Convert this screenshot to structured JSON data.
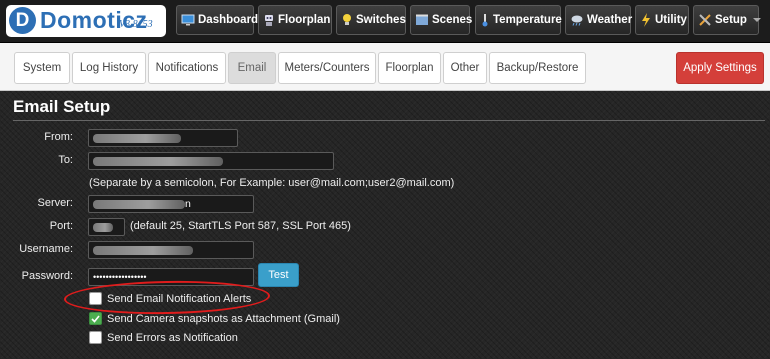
{
  "app": {
    "name": "Domoticz",
    "version": "V3.8153",
    "logo_letter": "D"
  },
  "nav": [
    {
      "label": "Dashboard",
      "icon": "monitor-icon"
    },
    {
      "label": "Floorplan",
      "icon": "robot-icon"
    },
    {
      "label": "Switches",
      "icon": "lightbulb-icon"
    },
    {
      "label": "Scenes",
      "icon": "film-icon"
    },
    {
      "label": "Temperature",
      "icon": "thermometer-icon"
    },
    {
      "label": "Weather",
      "icon": "cloud-rain-icon"
    },
    {
      "label": "Utility",
      "icon": "lightning-icon"
    },
    {
      "label": "Setup",
      "icon": "tools-icon",
      "dropdown": true
    }
  ],
  "tabs": [
    "System",
    "Log History",
    "Notifications",
    "Email",
    "Meters/Counters",
    "Floorplan",
    "Other",
    "Backup/Restore"
  ],
  "active_tab": "Email",
  "apply_button": "Apply Settings",
  "section_title": "Email Setup",
  "form": {
    "from_label": "From:",
    "to_label": "To:",
    "to_hint": "(Separate by a semicolon, For Example: user@mail.com;user2@mail.com)",
    "server_label": "Server:",
    "server_value_visible": "n",
    "port_label": "Port:",
    "port_hint": "(default 25, StartTLS Port 587, SSL Port 465)",
    "username_label": "Username:",
    "password_label": "Password:",
    "password_value": "•••••••••••••••••",
    "test_button": "Test",
    "checkboxes": [
      {
        "label": "Send Email Notification Alerts",
        "checked": false
      },
      {
        "label": "Send Camera snapshots as Attachment (Gmail)",
        "checked": true
      },
      {
        "label": "Send Errors as Notification",
        "checked": false
      }
    ]
  },
  "colors": {
    "brand_blue": "#2d6fb5",
    "apply_red": "#d43f3a",
    "test_blue": "#3a9fca",
    "check_green": "#4caf50",
    "annotation_red": "#e01c1c"
  }
}
